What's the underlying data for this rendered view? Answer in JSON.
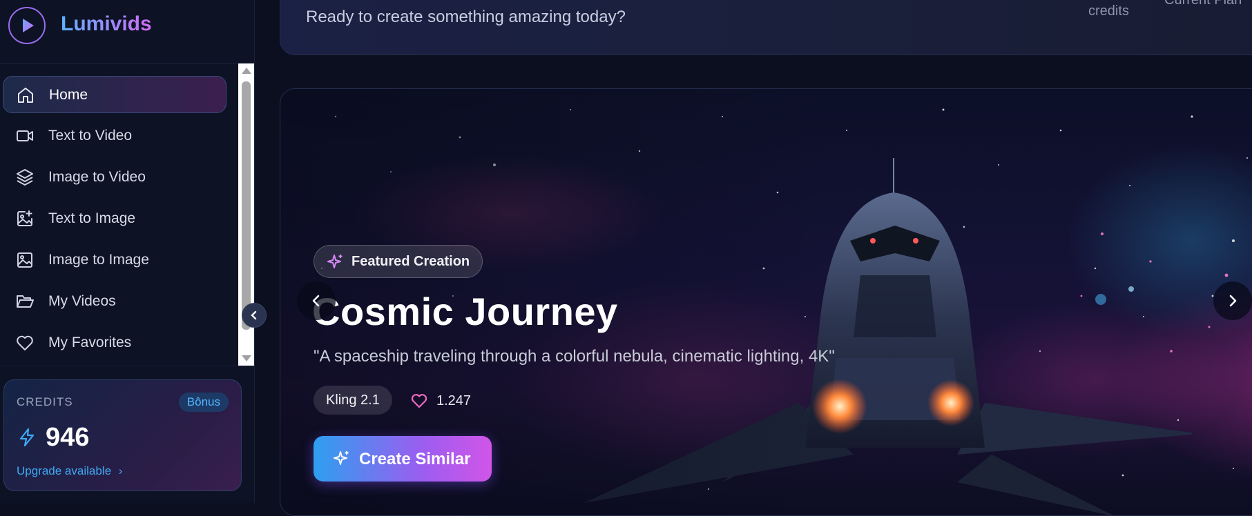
{
  "brand": {
    "name": "Lumivids"
  },
  "nav": {
    "items": [
      {
        "label": "Home",
        "icon": "home-icon",
        "active": true
      },
      {
        "label": "Text to Video",
        "icon": "video-camera-icon"
      },
      {
        "label": "Image to Video",
        "icon": "layers-icon"
      },
      {
        "label": "Text to Image",
        "icon": "image-plus-icon"
      },
      {
        "label": "Image to Image",
        "icon": "image-icon"
      },
      {
        "label": "My Videos",
        "icon": "folder-open-icon"
      },
      {
        "label": "My Favorites",
        "icon": "heart-icon"
      }
    ]
  },
  "credits_card": {
    "title": "CREDITS",
    "badge": "Bônus",
    "amount": "946",
    "upgrade_link": "Upgrade available"
  },
  "header": {
    "welcome_message": "Ready to create something amazing today?",
    "credits_label": "credits",
    "plan_label": "Current Plan"
  },
  "hero": {
    "badge": "Featured Creation",
    "title": "Cosmic Journey",
    "prompt": "\"A spaceship traveling through a colorful nebula, cinematic lighting, 4K\"",
    "model": "Kling 2.1",
    "likes": "1.247",
    "cta_label": "Create Similar"
  },
  "colors": {
    "background": "#0b0f1f",
    "sidebar": "#0d1224",
    "accent_blue": "#2e9ff0",
    "accent_purple": "#9a5ef0",
    "accent_pink": "#d055e8",
    "link_blue": "#3fa9f5"
  }
}
